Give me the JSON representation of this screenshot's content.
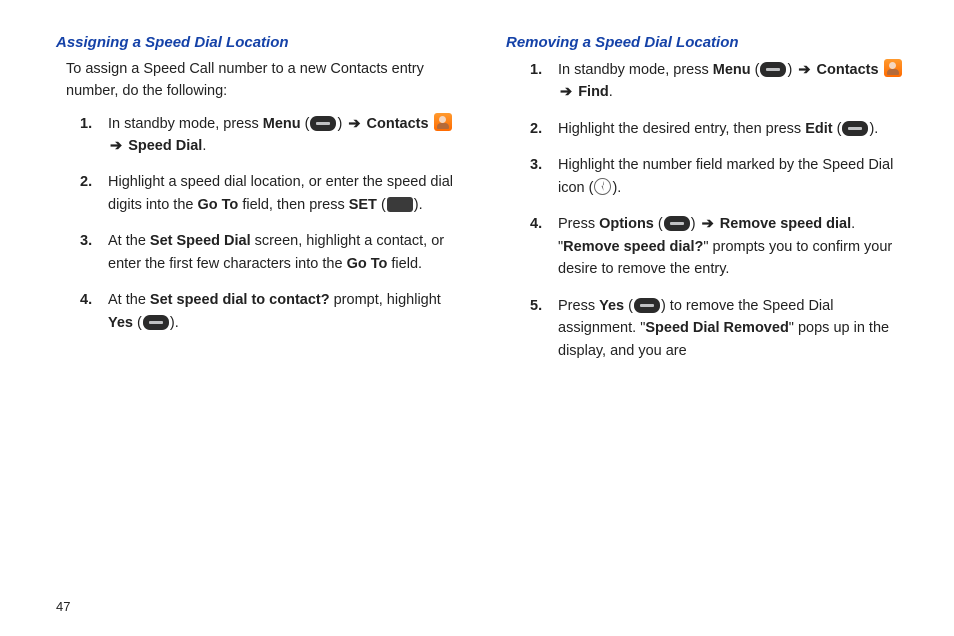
{
  "page_number": "47",
  "left": {
    "heading": "Assigning a Speed Dial Location",
    "intro": "To assign a Speed Call number to a new Contacts entry number, do the following:",
    "steps": {
      "s1a": "In standby mode, press ",
      "s1_menu": "Menu",
      "s1_contacts": " Contacts",
      "s1_speeddial": "Speed Dial",
      "s2a": "Highlight a speed dial location, or enter the speed dial digits into the ",
      "s2_goto": "Go To",
      "s2b": "  field, then press ",
      "s2_set": "SET",
      "s3a": "At the ",
      "s3_setspeed": "Set Speed Dial",
      "s3b": " screen, highlight a contact, or enter the first few characters into the ",
      "s3_goto": "Go To",
      "s3c": " field.",
      "s4a": "At the ",
      "s4_prompt": "Set speed dial to contact?",
      "s4b": " prompt, highlight ",
      "s4_yes": "Yes"
    }
  },
  "right": {
    "heading": "Removing a Speed Dial Location",
    "steps": {
      "s1a": "In standby mode, press ",
      "s1_menu": "Menu",
      "s1_contacts": " Contacts",
      "s1_find": "Find",
      "s2a": "Highlight the desired entry, then press ",
      "s2_edit": "Edit",
      "s3a": "Highlight the number field marked by the Speed Dial icon (",
      "s3b": ").",
      "s4a": "Press ",
      "s4_options": "Options",
      "s4_remove": " Remove speed dial",
      "s4b": ". \"",
      "s4_removeq": "Remove speed dial?",
      "s4c": "\" prompts you to confirm your desire to remove the entry.",
      "s5a": "Press ",
      "s5_yes": "Yes",
      "s5b": ") to remove the Speed Dial assignment. \"",
      "s5_removed": "Speed Dial Removed",
      "s5c": "\" pops up in the display, and you are"
    }
  },
  "arrow": "➔"
}
